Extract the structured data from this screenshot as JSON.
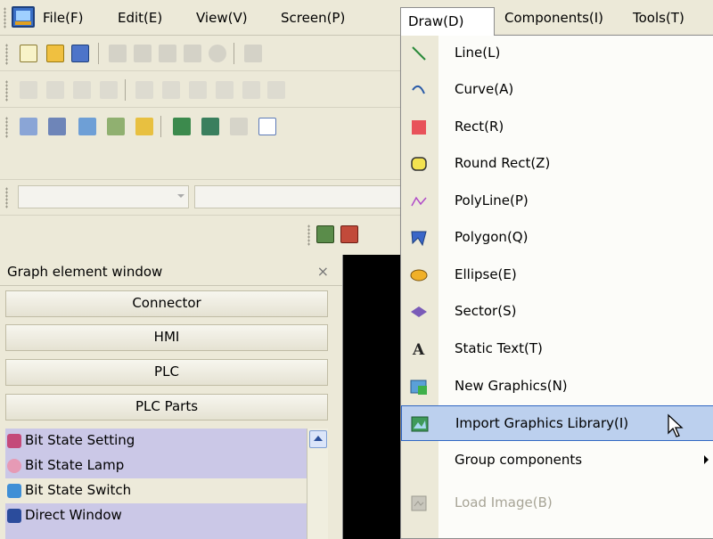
{
  "menubar": {
    "items": [
      "File(F)",
      "Edit(E)",
      "View(V)",
      "Screen(P)",
      "Draw(D)",
      "Components(I)",
      "Tools(T)"
    ]
  },
  "graph_window": {
    "title": "Graph element window",
    "close": "×",
    "buttons": [
      "Connector",
      "HMI",
      "PLC",
      "PLC Parts"
    ],
    "list": [
      "Bit State Setting",
      "Bit State Lamp",
      "Bit State Switch",
      "Direct Window"
    ]
  },
  "draw_menu": {
    "items": [
      {
        "label": "Line(L)",
        "icon": "line-icon"
      },
      {
        "label": "Curve(A)",
        "icon": "curve-icon"
      },
      {
        "label": "Rect(R)",
        "icon": "rect-icon"
      },
      {
        "label": "Round Rect(Z)",
        "icon": "round-rect-icon"
      },
      {
        "label": "PolyLine(P)",
        "icon": "polyline-icon"
      },
      {
        "label": "Polygon(Q)",
        "icon": "polygon-icon"
      },
      {
        "label": "Ellipse(E)",
        "icon": "ellipse-icon"
      },
      {
        "label": "Sector(S)",
        "icon": "sector-icon"
      },
      {
        "label": "Static Text(T)",
        "icon": "static-text-icon"
      },
      {
        "label": "New Graphics(N)",
        "icon": "new-graphics-icon"
      },
      {
        "label": "Import Graphics Library(I)",
        "icon": "import-graphics-icon",
        "highlighted": true
      },
      {
        "label": "Group components",
        "icon": "",
        "submenu": true
      },
      {
        "label": "Load Image(B)",
        "icon": "load-image-icon",
        "disabled": true
      }
    ]
  },
  "colors": {
    "menu_highlight": "#bcd0ee",
    "highlight_border": "#3167c2",
    "list_background": "#cbc8e7"
  }
}
